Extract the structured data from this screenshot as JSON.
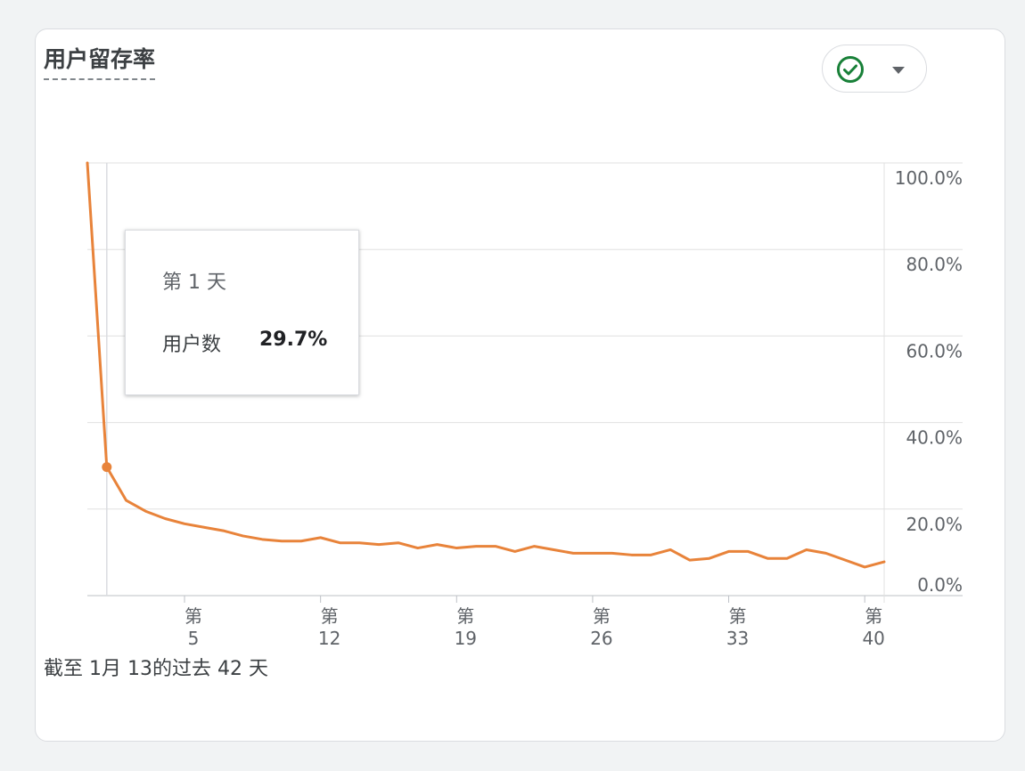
{
  "card": {
    "title": "用户留存率",
    "footer": "截至 1月 13的过去 42 天"
  },
  "status": {
    "icon": "check-circle-icon",
    "icon_color": "#188038",
    "dropdown_icon": "caret-down-icon"
  },
  "tooltip": {
    "title": "第 1 天",
    "label": "用户数",
    "value": "29.7%"
  },
  "colors": {
    "line": "#e8833a",
    "grid": "#e0e0e0",
    "axis_text": "#5f6368"
  },
  "chart_data": {
    "type": "line",
    "title": "用户留存率",
    "x_label_prefix": "第",
    "x_tick_values": [
      5,
      12,
      19,
      26,
      33,
      40
    ],
    "y_tick_labels": [
      "0.0%",
      "20.0%",
      "40.0%",
      "60.0%",
      "80.0%",
      "100.0%"
    ],
    "y_tick_values": [
      0,
      20,
      40,
      60,
      80,
      100
    ],
    "ylim": [
      0,
      100
    ],
    "xlim": [
      0,
      41
    ],
    "grid": true,
    "highlight_x": 1,
    "series": [
      {
        "x": [
          0,
          1,
          2,
          3,
          4,
          5,
          6,
          7,
          8,
          9,
          10,
          11,
          12,
          13,
          14,
          15,
          16,
          17,
          18,
          19,
          20,
          21,
          22,
          23,
          24,
          25,
          26,
          27,
          28,
          29,
          30,
          31,
          32,
          33,
          34,
          35,
          36,
          37,
          38,
          39,
          40,
          41
        ],
        "values": [
          100,
          29.7,
          22,
          19.5,
          17.8,
          16.6,
          15.8,
          15,
          13.8,
          13,
          12.6,
          12.6,
          13.4,
          12.2,
          12.2,
          11.8,
          12.2,
          11,
          11.8,
          11,
          11.4,
          11.4,
          10.2,
          11.4,
          10.6,
          9.8,
          9.8,
          9.8,
          9.4,
          9.4,
          10.6,
          8.2,
          8.6,
          10.2,
          10.2,
          8.6,
          8.6,
          10.6,
          9.8,
          8.2,
          6.6,
          7.8
        ]
      }
    ]
  }
}
